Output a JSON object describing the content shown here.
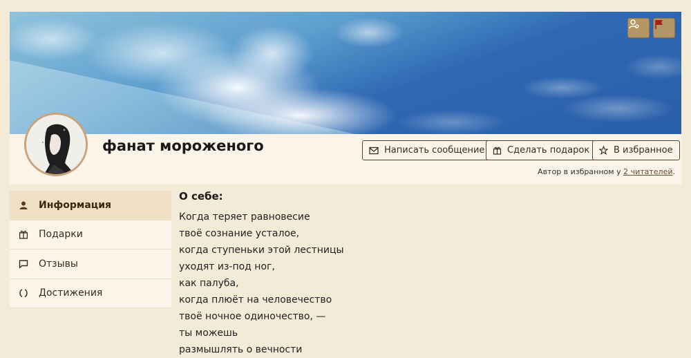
{
  "profile": {
    "username": "фанат мороженого",
    "favorites_note_prefix": "Автор в избранном у",
    "favorites_link": "2 читателей",
    "favorites_note_suffix": "."
  },
  "actions": {
    "message": "Написать сообщение",
    "gift": "Сделать подарок",
    "favorite": "В избранное"
  },
  "top_icons": [
    "user-settings-icon",
    "flag-icon"
  ],
  "nav": {
    "items": [
      {
        "label": "Информация",
        "icon": "person-icon",
        "active": true
      },
      {
        "label": "Подарки",
        "icon": "gift-icon",
        "active": false
      },
      {
        "label": "Отзывы",
        "icon": "comment-icon",
        "active": false
      },
      {
        "label": "Достижения",
        "icon": "laurel-icon",
        "active": false
      }
    ]
  },
  "about": {
    "title": "О себе:",
    "lines": [
      "Когда теряет равновесие",
      "твоё сознание усталое,",
      "когда ступеньки этой лестницы",
      "уходят из-под ног,",
      "как палуба,",
      "когда плюёт на человечество",
      "твоё ночное одиночество, —",
      "ты можешь",
      "размышлять о вечности"
    ]
  },
  "colors": {
    "page_bg": "#f4ead8",
    "card_bg": "#fbf5e9",
    "accent_brown": "#b39566",
    "active_nav": "#efe0c5"
  }
}
